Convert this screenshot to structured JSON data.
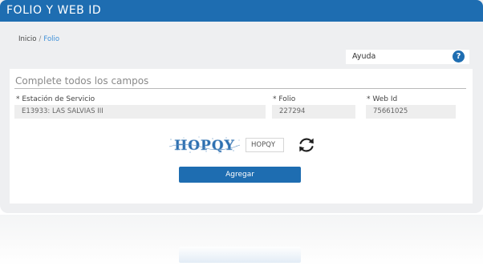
{
  "header": {
    "title": "FOLIO Y WEB ID"
  },
  "breadcrumb": {
    "home": "Inicio",
    "separator": "/",
    "current": "Folio"
  },
  "help": {
    "label": "Ayuda",
    "icon": "help-icon",
    "icon_glyph": "?"
  },
  "form": {
    "section_title": "Complete todos los campos",
    "fields": {
      "station": {
        "label": "* Estación de Servicio",
        "value": "E13933: LAS SALVIAS III"
      },
      "folio": {
        "label": "* Folio",
        "value": "227294"
      },
      "webid": {
        "label": "* Web Id",
        "value": "75661025"
      }
    },
    "captcha": {
      "image_text": "HOPQY",
      "input_value": "HOPQY",
      "refresh_icon": "refresh-icon"
    },
    "submit_label": "Agregar"
  },
  "colors": {
    "brand": "#1e6db1",
    "link": "#3d8fd8",
    "panel_bg": "#eeeff1",
    "captcha_text": "#2c6fb0"
  }
}
